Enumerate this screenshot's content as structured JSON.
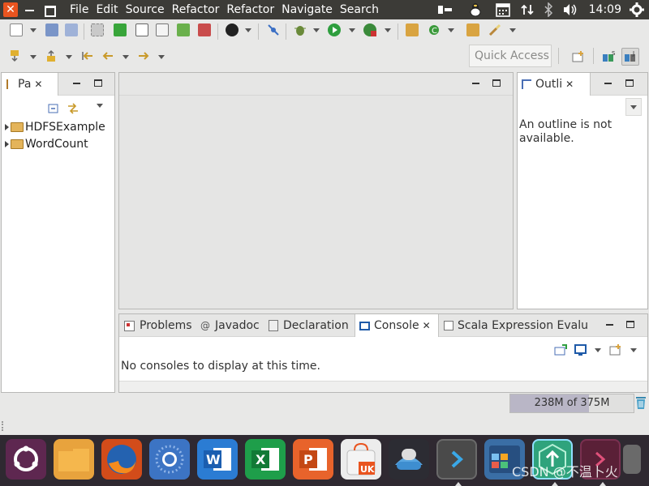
{
  "topbar": {
    "close_glyph": "✕",
    "menus": [
      "File",
      "Edit",
      "Source",
      "Refactor",
      "Refactor",
      "Navigate",
      "Search"
    ],
    "clock": "14:09",
    "tray_icons": [
      "keyboard-layout-icon",
      "linux-icon",
      "calendar-icon",
      "network-icon",
      "bluetooth-icon",
      "volume-icon",
      "settings-gear-icon"
    ]
  },
  "toolbar": {
    "quick_access_placeholder": "Quick Access"
  },
  "package_explorer": {
    "tab_label": "Pa",
    "items": [
      {
        "label": "HDFSExample"
      },
      {
        "label": "WordCount"
      }
    ]
  },
  "outline": {
    "tab_label": "Outli",
    "message": "An outline is not available."
  },
  "bottom_panel": {
    "tabs": [
      {
        "label": "Problems",
        "icon": "problems-icon",
        "active": false
      },
      {
        "label": "Javadoc",
        "icon": "at-icon",
        "active": false
      },
      {
        "label": "Declaration",
        "icon": "declaration-icon",
        "active": false
      },
      {
        "label": "Console",
        "icon": "console-icon",
        "active": true
      },
      {
        "label": "Scala Expression Evalu",
        "icon": "scala-eval-icon",
        "active": false
      }
    ],
    "console_message": "No consoles to display at this time."
  },
  "status": {
    "heap_text": "238M of 375M",
    "heap_used_fraction": 0.635
  },
  "dock": {
    "apps": [
      {
        "name": "ubuntu-launcher",
        "color": "#5e2750"
      },
      {
        "name": "files",
        "color": "#e8a33d"
      },
      {
        "name": "firefox",
        "color": "#e66000"
      },
      {
        "name": "chromium",
        "color": "#4a78c2"
      },
      {
        "name": "word",
        "color": "#2b7cd3",
        "glyph": "W"
      },
      {
        "name": "excel",
        "color": "#1e9e4a",
        "glyph": "X"
      },
      {
        "name": "powerpoint",
        "color": "#e8632b",
        "glyph": "P"
      },
      {
        "name": "ubuntu-software",
        "color": "#e0e0e0",
        "glyph": "UK"
      },
      {
        "name": "remmina",
        "color": "#3e8ed0"
      },
      {
        "name": "visual-studio-code",
        "color": "#4a4a4a",
        "glyph": ">"
      },
      {
        "name": "workspace-switcher",
        "color": "#3a6ea5"
      },
      {
        "name": "upgrade",
        "color": "#2fa37c",
        "glyph": "↑"
      },
      {
        "name": "terminal",
        "color": "#5a2037",
        "glyph": ">"
      }
    ],
    "watermark": "CSDN @不温卜火"
  }
}
